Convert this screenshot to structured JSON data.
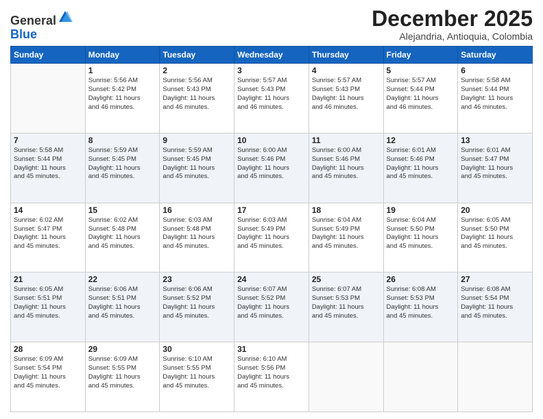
{
  "header": {
    "logo_general": "General",
    "logo_blue": "Blue",
    "month_title": "December 2025",
    "subtitle": "Alejandria, Antioquia, Colombia"
  },
  "weekdays": [
    "Sunday",
    "Monday",
    "Tuesday",
    "Wednesday",
    "Thursday",
    "Friday",
    "Saturday"
  ],
  "weeks": [
    [
      {
        "day": "",
        "sunrise": "",
        "sunset": "",
        "daylight": ""
      },
      {
        "day": "1",
        "sunrise": "Sunrise: 5:56 AM",
        "sunset": "Sunset: 5:42 PM",
        "daylight": "Daylight: 11 hours and 46 minutes."
      },
      {
        "day": "2",
        "sunrise": "Sunrise: 5:56 AM",
        "sunset": "Sunset: 5:43 PM",
        "daylight": "Daylight: 11 hours and 46 minutes."
      },
      {
        "day": "3",
        "sunrise": "Sunrise: 5:57 AM",
        "sunset": "Sunset: 5:43 PM",
        "daylight": "Daylight: 11 hours and 46 minutes."
      },
      {
        "day": "4",
        "sunrise": "Sunrise: 5:57 AM",
        "sunset": "Sunset: 5:43 PM",
        "daylight": "Daylight: 11 hours and 46 minutes."
      },
      {
        "day": "5",
        "sunrise": "Sunrise: 5:57 AM",
        "sunset": "Sunset: 5:44 PM",
        "daylight": "Daylight: 11 hours and 46 minutes."
      },
      {
        "day": "6",
        "sunrise": "Sunrise: 5:58 AM",
        "sunset": "Sunset: 5:44 PM",
        "daylight": "Daylight: 11 hours and 46 minutes."
      }
    ],
    [
      {
        "day": "7",
        "sunrise": "Sunrise: 5:58 AM",
        "sunset": "Sunset: 5:44 PM",
        "daylight": "Daylight: 11 hours and 45 minutes."
      },
      {
        "day": "8",
        "sunrise": "Sunrise: 5:59 AM",
        "sunset": "Sunset: 5:45 PM",
        "daylight": "Daylight: 11 hours and 45 minutes."
      },
      {
        "day": "9",
        "sunrise": "Sunrise: 5:59 AM",
        "sunset": "Sunset: 5:45 PM",
        "daylight": "Daylight: 11 hours and 45 minutes."
      },
      {
        "day": "10",
        "sunrise": "Sunrise: 6:00 AM",
        "sunset": "Sunset: 5:46 PM",
        "daylight": "Daylight: 11 hours and 45 minutes."
      },
      {
        "day": "11",
        "sunrise": "Sunrise: 6:00 AM",
        "sunset": "Sunset: 5:46 PM",
        "daylight": "Daylight: 11 hours and 45 minutes."
      },
      {
        "day": "12",
        "sunrise": "Sunrise: 6:01 AM",
        "sunset": "Sunset: 5:46 PM",
        "daylight": "Daylight: 11 hours and 45 minutes."
      },
      {
        "day": "13",
        "sunrise": "Sunrise: 6:01 AM",
        "sunset": "Sunset: 5:47 PM",
        "daylight": "Daylight: 11 hours and 45 minutes."
      }
    ],
    [
      {
        "day": "14",
        "sunrise": "Sunrise: 6:02 AM",
        "sunset": "Sunset: 5:47 PM",
        "daylight": "Daylight: 11 hours and 45 minutes."
      },
      {
        "day": "15",
        "sunrise": "Sunrise: 6:02 AM",
        "sunset": "Sunset: 5:48 PM",
        "daylight": "Daylight: 11 hours and 45 minutes."
      },
      {
        "day": "16",
        "sunrise": "Sunrise: 6:03 AM",
        "sunset": "Sunset: 5:48 PM",
        "daylight": "Daylight: 11 hours and 45 minutes."
      },
      {
        "day": "17",
        "sunrise": "Sunrise: 6:03 AM",
        "sunset": "Sunset: 5:49 PM",
        "daylight": "Daylight: 11 hours and 45 minutes."
      },
      {
        "day": "18",
        "sunrise": "Sunrise: 6:04 AM",
        "sunset": "Sunset: 5:49 PM",
        "daylight": "Daylight: 11 hours and 45 minutes."
      },
      {
        "day": "19",
        "sunrise": "Sunrise: 6:04 AM",
        "sunset": "Sunset: 5:50 PM",
        "daylight": "Daylight: 11 hours and 45 minutes."
      },
      {
        "day": "20",
        "sunrise": "Sunrise: 6:05 AM",
        "sunset": "Sunset: 5:50 PM",
        "daylight": "Daylight: 11 hours and 45 minutes."
      }
    ],
    [
      {
        "day": "21",
        "sunrise": "Sunrise: 6:05 AM",
        "sunset": "Sunset: 5:51 PM",
        "daylight": "Daylight: 11 hours and 45 minutes."
      },
      {
        "day": "22",
        "sunrise": "Sunrise: 6:06 AM",
        "sunset": "Sunset: 5:51 PM",
        "daylight": "Daylight: 11 hours and 45 minutes."
      },
      {
        "day": "23",
        "sunrise": "Sunrise: 6:06 AM",
        "sunset": "Sunset: 5:52 PM",
        "daylight": "Daylight: 11 hours and 45 minutes."
      },
      {
        "day": "24",
        "sunrise": "Sunrise: 6:07 AM",
        "sunset": "Sunset: 5:52 PM",
        "daylight": "Daylight: 11 hours and 45 minutes."
      },
      {
        "day": "25",
        "sunrise": "Sunrise: 6:07 AM",
        "sunset": "Sunset: 5:53 PM",
        "daylight": "Daylight: 11 hours and 45 minutes."
      },
      {
        "day": "26",
        "sunrise": "Sunrise: 6:08 AM",
        "sunset": "Sunset: 5:53 PM",
        "daylight": "Daylight: 11 hours and 45 minutes."
      },
      {
        "day": "27",
        "sunrise": "Sunrise: 6:08 AM",
        "sunset": "Sunset: 5:54 PM",
        "daylight": "Daylight: 11 hours and 45 minutes."
      }
    ],
    [
      {
        "day": "28",
        "sunrise": "Sunrise: 6:09 AM",
        "sunset": "Sunset: 5:54 PM",
        "daylight": "Daylight: 11 hours and 45 minutes."
      },
      {
        "day": "29",
        "sunrise": "Sunrise: 6:09 AM",
        "sunset": "Sunset: 5:55 PM",
        "daylight": "Daylight: 11 hours and 45 minutes."
      },
      {
        "day": "30",
        "sunrise": "Sunrise: 6:10 AM",
        "sunset": "Sunset: 5:55 PM",
        "daylight": "Daylight: 11 hours and 45 minutes."
      },
      {
        "day": "31",
        "sunrise": "Sunrise: 6:10 AM",
        "sunset": "Sunset: 5:56 PM",
        "daylight": "Daylight: 11 hours and 45 minutes."
      },
      {
        "day": "",
        "sunrise": "",
        "sunset": "",
        "daylight": ""
      },
      {
        "day": "",
        "sunrise": "",
        "sunset": "",
        "daylight": ""
      },
      {
        "day": "",
        "sunrise": "",
        "sunset": "",
        "daylight": ""
      }
    ]
  ]
}
